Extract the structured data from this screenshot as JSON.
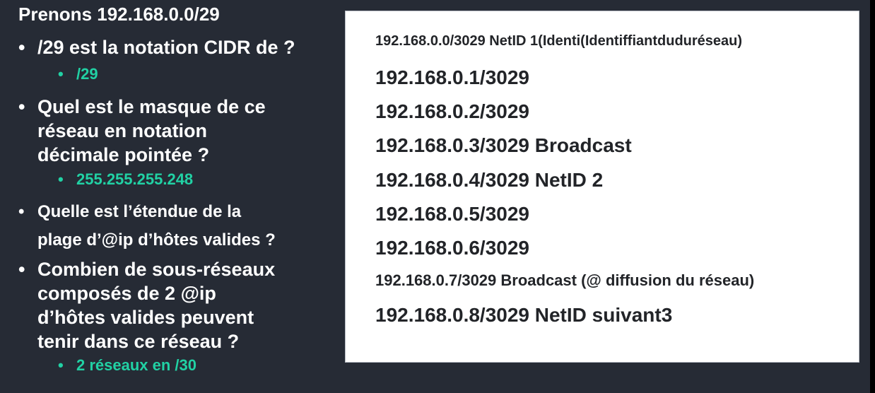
{
  "slide": {
    "title": "Prenons 192.168.0.0/29",
    "bullet_char": "•",
    "questions": [
      {
        "lines": [
          "/29 est la notation CIDR de ?"
        ],
        "answer": "/29"
      },
      {
        "lines": [
          "Quel est le masque de ce",
          "réseau en notation",
          "décimale pointée ?"
        ],
        "answer": "255.255.255.248"
      },
      {
        "lines": [
          "Quelle est l’étendue de la",
          "plage d’@ip d’hôtes valides ?"
        ],
        "answer": ""
      },
      {
        "lines": [
          "Combien de sous-réseaux",
          "composés de 2 @ip",
          "d’hôtes valides peuvent",
          "tenir dans ce réseau ?"
        ],
        "answer": "2 réseaux en /30"
      }
    ],
    "panel_lines": [
      "192.168.0.0/3029 NetID 1(Identi(Identiffiantduduréseau)",
      "192.168.0.1/3029",
      "192.168.0.2/3029",
      "192.168.0.3/3029 Broadcast",
      "192.168.0.4/3029 NetID 2",
      "192.168.0.5/3029",
      "192.168.0.6/3029",
      "192.168.0.7/3029 Broadcast (@ diffusion du réseau)",
      "192.168.0.8/3029 NetID suivant3"
    ],
    "colors": {
      "background": "#262b35",
      "answer": "#21d1a4",
      "panel_text": "#222428"
    }
  }
}
